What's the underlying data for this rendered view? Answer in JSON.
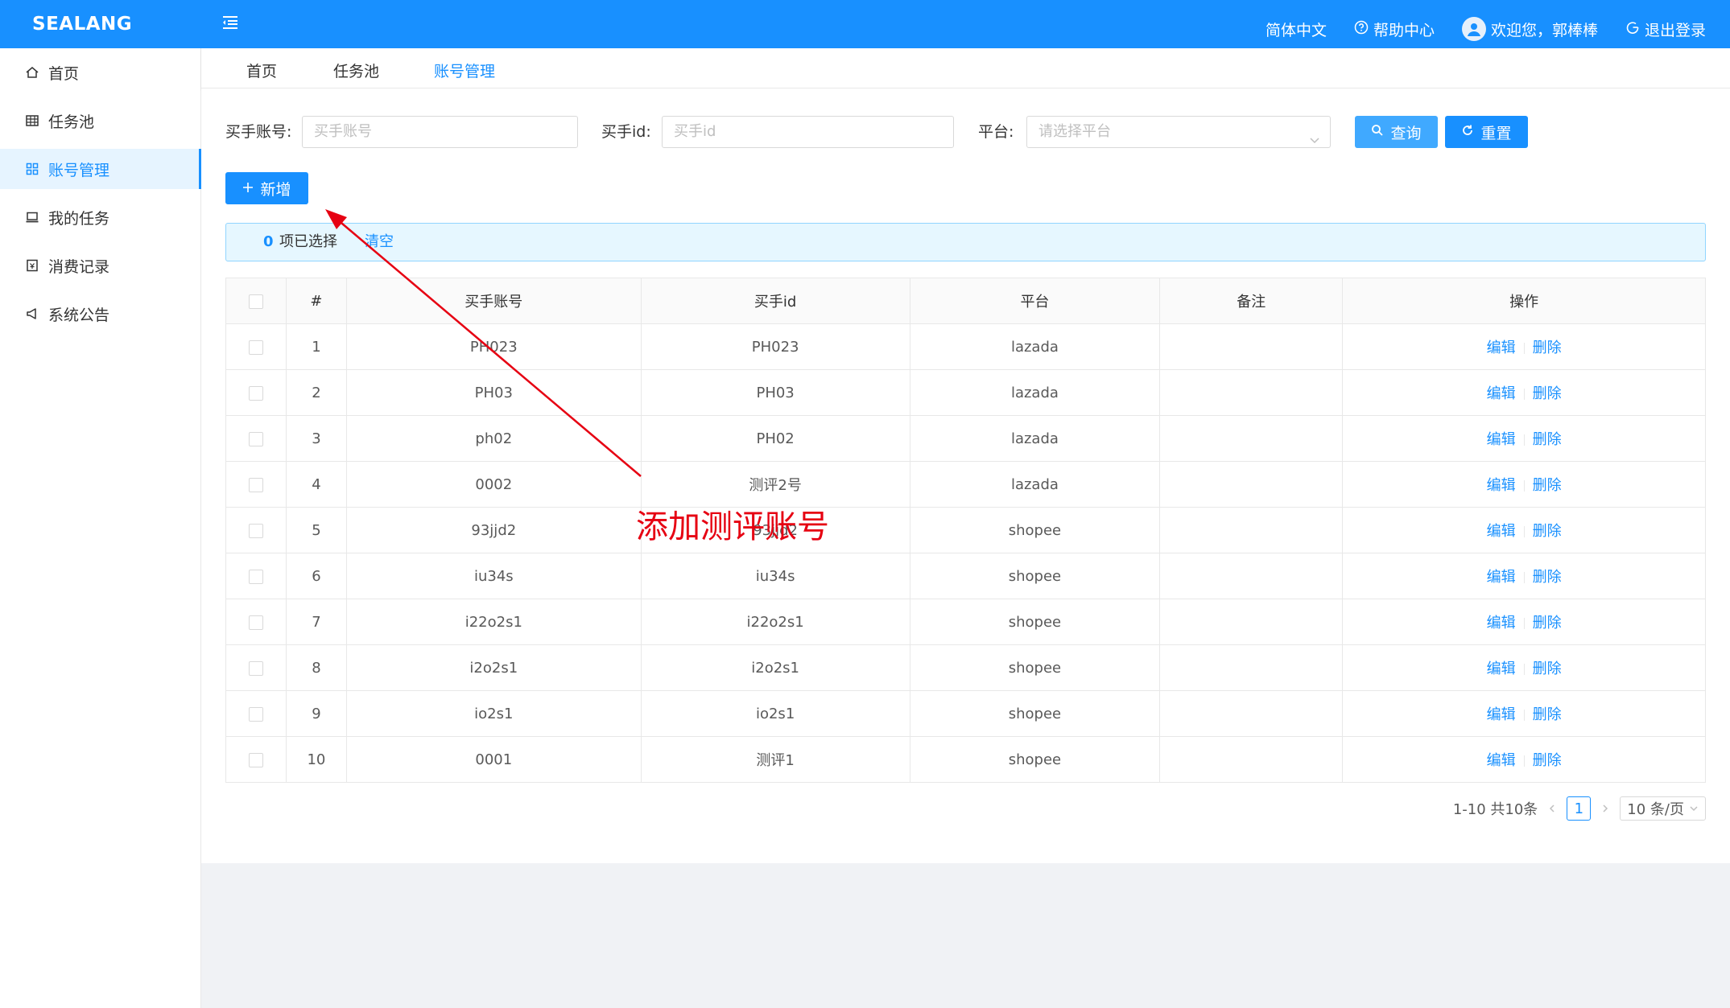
{
  "header": {
    "logo": "SEALANG",
    "language": "简体中文",
    "help": "帮助中心",
    "welcome": "欢迎您，郭棒棒",
    "logout": "退出登录"
  },
  "sidebar": {
    "items": [
      {
        "label": "首页",
        "icon": "home-icon"
      },
      {
        "label": "任务池",
        "icon": "table-icon"
      },
      {
        "label": "账号管理",
        "icon": "apps-icon"
      },
      {
        "label": "我的任务",
        "icon": "laptop-icon"
      },
      {
        "label": "消费记录",
        "icon": "receipt-icon"
      },
      {
        "label": "系统公告",
        "icon": "megaphone-icon"
      }
    ],
    "active_index": 2
  },
  "tabs": [
    {
      "label": "首页"
    },
    {
      "label": "任务池"
    },
    {
      "label": "账号管理"
    }
  ],
  "search": {
    "account_label": "买手账号:",
    "account_placeholder": "买手账号",
    "id_label": "买手id:",
    "id_placeholder": "买手id",
    "platform_label": "平台:",
    "platform_placeholder": "请选择平台",
    "query_btn": "查询",
    "reset_btn": "重置"
  },
  "toolbar": {
    "add_btn": "新增"
  },
  "selection": {
    "count": "0",
    "text": "项已选择",
    "clear": "清空"
  },
  "table": {
    "columns": [
      "#",
      "买手账号",
      "买手id",
      "平台",
      "备注",
      "操作"
    ],
    "edit_label": "编辑",
    "delete_label": "删除",
    "rows": [
      {
        "no": "1",
        "account": "PH023",
        "id": "PH023",
        "platform": "lazada",
        "remark": ""
      },
      {
        "no": "2",
        "account": "PH03",
        "id": "PH03",
        "platform": "lazada",
        "remark": ""
      },
      {
        "no": "3",
        "account": "ph02",
        "id": "PH02",
        "platform": "lazada",
        "remark": ""
      },
      {
        "no": "4",
        "account": "0002",
        "id": "测评2号",
        "platform": "lazada",
        "remark": ""
      },
      {
        "no": "5",
        "account": "93jjd2",
        "id": "93jjd2",
        "platform": "shopee",
        "remark": ""
      },
      {
        "no": "6",
        "account": "iu34s",
        "id": "iu34s",
        "platform": "shopee",
        "remark": ""
      },
      {
        "no": "7",
        "account": "i22o2s1",
        "id": "i22o2s1",
        "platform": "shopee",
        "remark": ""
      },
      {
        "no": "8",
        "account": "i2o2s1",
        "id": "i2o2s1",
        "platform": "shopee",
        "remark": ""
      },
      {
        "no": "9",
        "account": "io2s1",
        "id": "io2s1",
        "platform": "shopee",
        "remark": ""
      },
      {
        "no": "10",
        "account": "0001",
        "id": "测评1",
        "platform": "shopee",
        "remark": ""
      }
    ]
  },
  "pagination": {
    "summary": "1-10 共10条",
    "current": "1",
    "page_size": "10 条/页"
  },
  "annotation": {
    "text": "添加测评账号",
    "color": "#e60012"
  },
  "colors": {
    "primary": "#1890ff",
    "light": "#40a9ff"
  }
}
